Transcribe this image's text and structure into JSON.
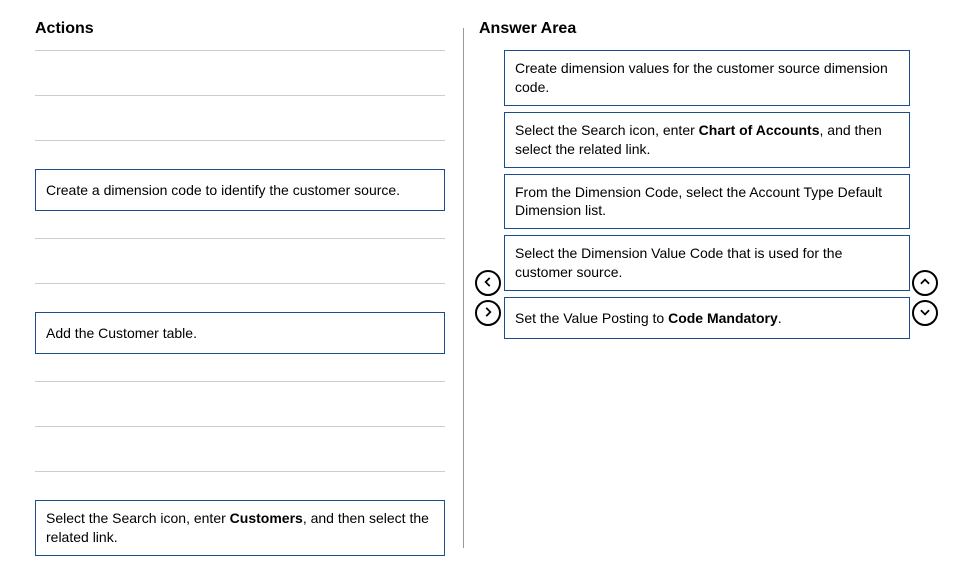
{
  "headers": {
    "actions": "Actions",
    "answer": "Answer Area"
  },
  "actions": {
    "item1_text": "Create a dimension code to identify the customer source.",
    "item2_text": "Add the Customer table.",
    "item3_prefix": "Select the Search icon, enter ",
    "item3_bold": "Customers",
    "item3_suffix": ", and then select the related link."
  },
  "answers": {
    "a1": "Create dimension values for the customer source dimension code.",
    "a2_prefix": "Select the Search icon, enter ",
    "a2_bold": "Chart of Accounts",
    "a2_suffix": ", and then select the related link.",
    "a3": "From the Dimension Code, select the Account Type Default Dimension list.",
    "a4": "Select the Dimension Value Code that is used for the customer source.",
    "a5_prefix": "Set the Value Posting to ",
    "a5_bold": "Code Mandatory",
    "a5_suffix": "."
  }
}
